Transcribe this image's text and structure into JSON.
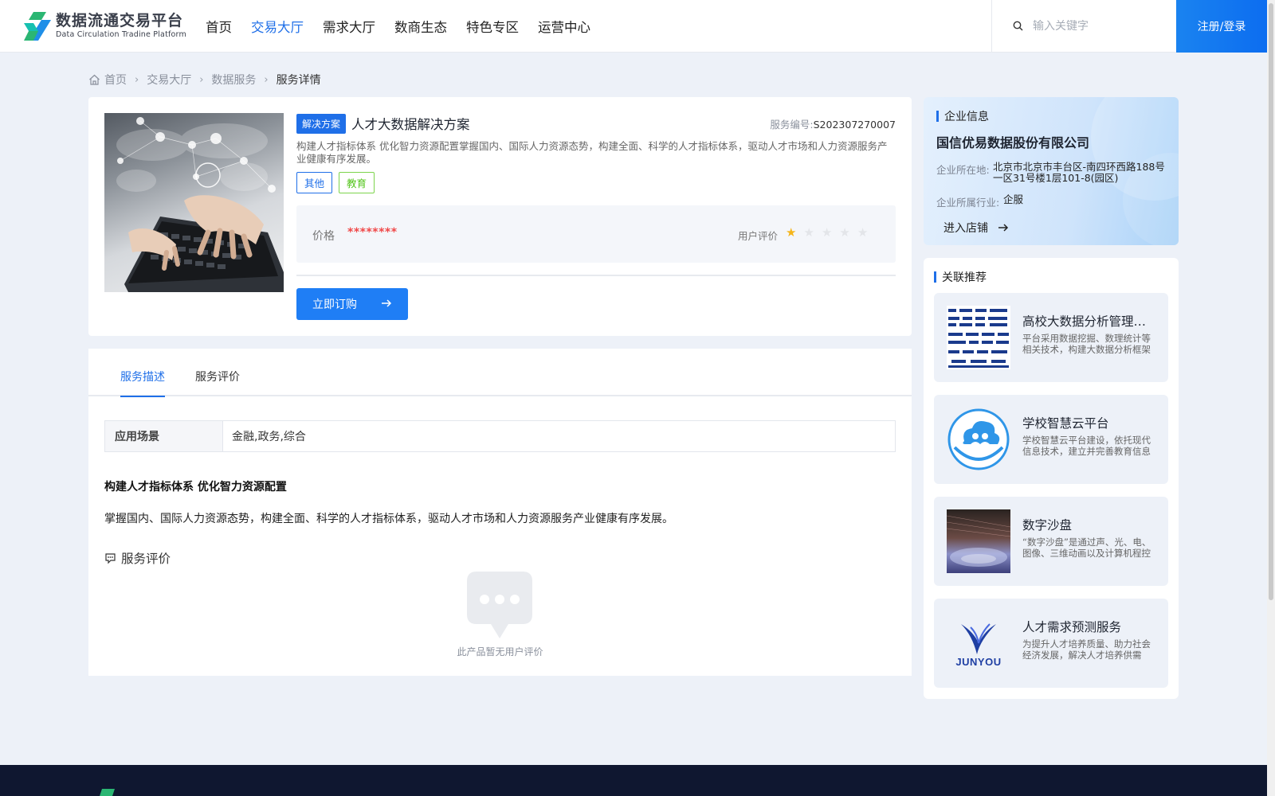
{
  "header": {
    "logo_cn": "数据流通交易平台",
    "logo_en": "Data Circulation Tradine Platform",
    "nav": [
      {
        "label": "首页"
      },
      {
        "label": "交易大厅"
      },
      {
        "label": "需求大厅"
      },
      {
        "label": "数商生态"
      },
      {
        "label": "特色专区"
      },
      {
        "label": "运营中心"
      }
    ],
    "active_nav": "交易大厅",
    "search_placeholder": "输入关键字",
    "login_label": "注册/登录"
  },
  "breadcrumb": {
    "items": [
      "首页",
      "交易大厅",
      "数据服务",
      "服务详情"
    ]
  },
  "product": {
    "tag": "解决方案",
    "title": "人才大数据解决方案",
    "serial_label": "服务编号:",
    "serial_value": "S202307270007",
    "description": "构建人才指标体系 优化智力资源配置掌握国内、国际人力资源态势，构建全面、科学的人才指标体系，驱动人才市场和人力资源服务产业健康有序发展。",
    "tags": [
      "其他",
      "教育"
    ],
    "price_label": "价格",
    "price_value": "********",
    "rating_label": "用户评价",
    "rating": 1,
    "rating_max": 5,
    "buy_label": "立即订购"
  },
  "tabs": {
    "items": [
      "服务描述",
      "服务评价"
    ],
    "active": "服务描述"
  },
  "description": {
    "scene_label": "应用场景",
    "scene_value": "金融,政务,综合",
    "heading": "构建人才指标体系 优化智力资源配置",
    "body": "掌握国内、国际人力资源态势，构建全面、科学的人才指标体系，驱动人才市场和人力资源服务产业健康有序发展。"
  },
  "reviews": {
    "title": "服务评价",
    "empty_text": "此产品暂无用户评价"
  },
  "company": {
    "section_title": "企业信息",
    "name": "国信优易数据股份有限公司",
    "location_label": "企业所在地:",
    "location_value": "北京市北京市丰台区-南四环西路188号一区31号楼1层101-8(园区)",
    "industry_label": "企业所属行业:",
    "industry_value": "企服",
    "shop_label": "进入店铺"
  },
  "recommend": {
    "section_title": "关联推荐",
    "items": [
      {
        "title": "高校大数据分析管理平台",
        "desc": "平台采用数据挖掘、数理统计等相关技术，构建大数据分析框架"
      },
      {
        "title": "学校智慧云平台",
        "desc": "学校智慧云平台建设，依托现代信息技术，建立并完善教育信息"
      },
      {
        "title": "数字沙盘",
        "desc": "“数字沙盘”是通过声、光、电、图像、三维动画以及计算机程控"
      },
      {
        "title": "人才需求预测服务",
        "desc": "为提升人才培养质量、助力社会经济发展，解决人才培养供需"
      }
    ],
    "junyou_logo_text": "JUNYOU"
  },
  "colors": {
    "brand_blue": "#1f6fe8",
    "price_red": "#f04848",
    "star_gold": "#f5b51a",
    "tag_green": "#52c41a",
    "footer_navy": "#0f1730"
  }
}
